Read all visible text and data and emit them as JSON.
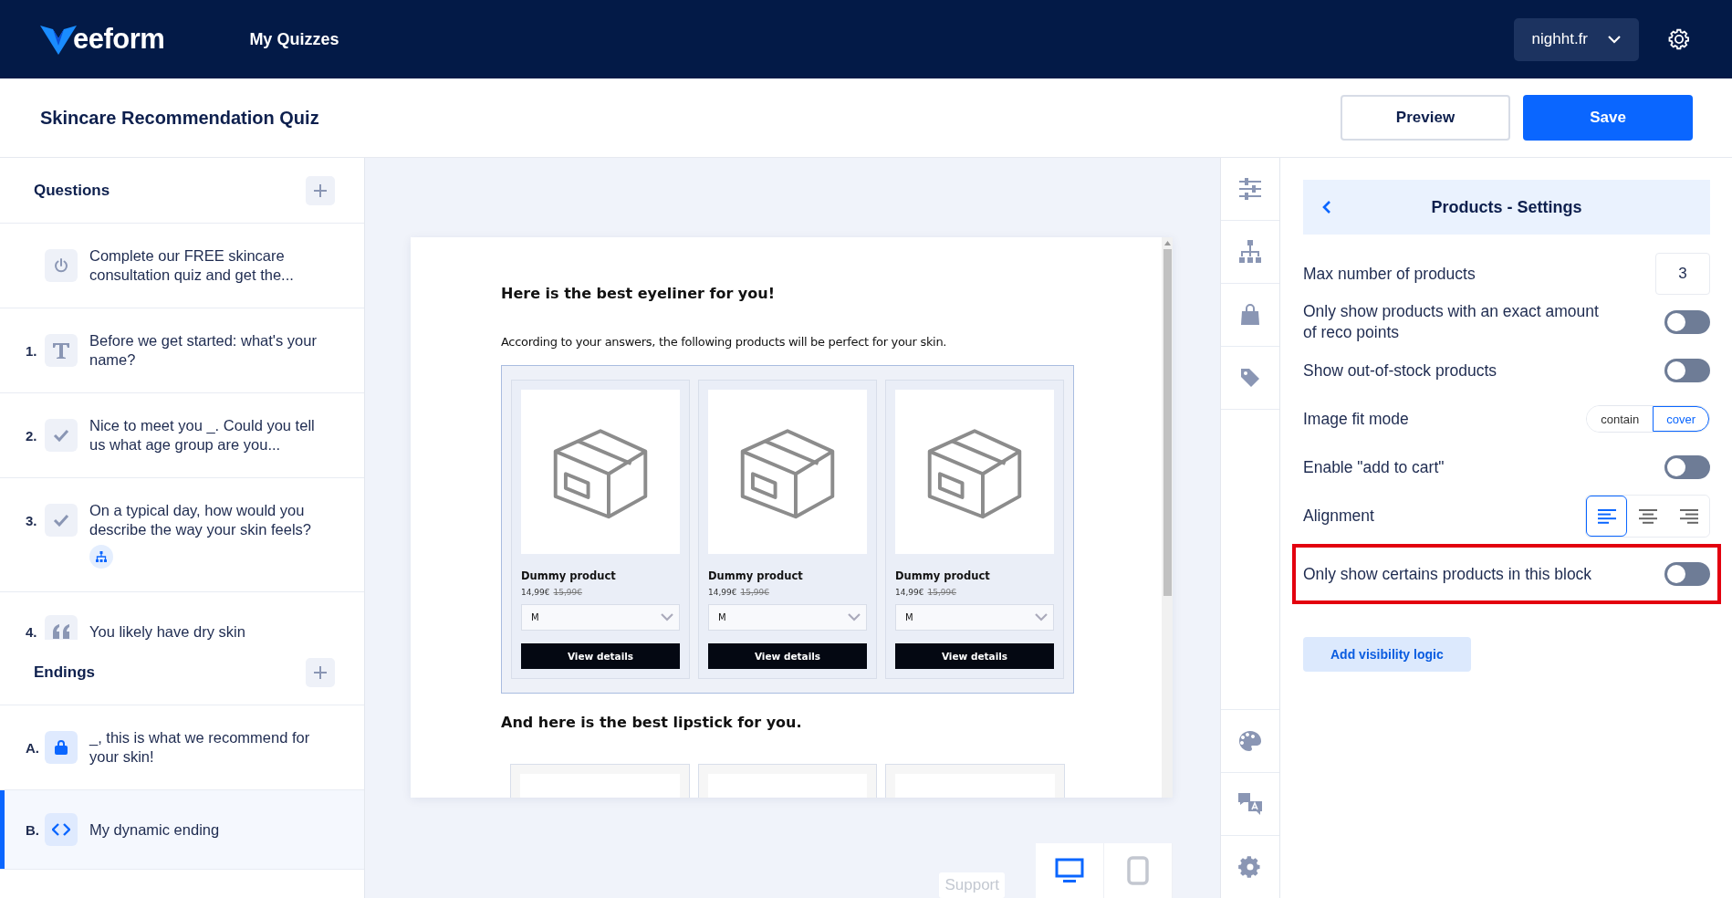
{
  "header": {
    "logo_text": "eeform",
    "nav": [
      {
        "label": "My Quizzes"
      }
    ],
    "account": "nighht.fr"
  },
  "toolbar": {
    "title": "Skincare Recommendation Quiz",
    "buttons": [
      {
        "label": "Preview",
        "kind": "secondary"
      },
      {
        "label": "Save",
        "kind": "primary"
      }
    ]
  },
  "sidebar": {
    "sections": [
      {
        "title": "Questions",
        "items": [
          {
            "kind": "intro",
            "text": "Complete our FREE skincare consultation quiz and get the...",
            "has_logic": false,
            "selected": false
          },
          {
            "number": "1.",
            "kind": "text",
            "text": "Before we get started: what's your name?",
            "has_logic": false,
            "selected": false
          },
          {
            "number": "2.",
            "kind": "choice",
            "text": "Nice to meet you _. Could you tell us what age group are you...",
            "has_logic": false,
            "selected": false
          },
          {
            "number": "3.",
            "kind": "choice",
            "text": "On a typical day, how would you describe the way your skin feels?",
            "has_logic": true,
            "selected": false
          },
          {
            "number": "4.",
            "kind": "quote",
            "text": "You likely have dry skin",
            "has_logic": false,
            "selected": false
          }
        ]
      },
      {
        "title": "Endings",
        "items": [
          {
            "number": "A.",
            "kind": "product",
            "text": "_, this is what we recommend for your skin!",
            "has_logic": false,
            "selected": false
          },
          {
            "number": "B.",
            "kind": "code",
            "text": "My dynamic ending",
            "has_logic": false,
            "selected": true
          }
        ]
      }
    ]
  },
  "preview": {
    "blocks": [
      {
        "heading": "Here is the best eyeliner for you!",
        "text": "According to your answers, the following products will be perfect for your skin.",
        "products": [
          {
            "kind": "full",
            "name": "Dummy product",
            "price": "14,99€",
            "old_price": "15,99€",
            "variant": "M",
            "button": "View details"
          },
          {
            "kind": "full",
            "name": "Dummy product",
            "price": "14,99€",
            "old_price": "15,99€",
            "variant": "M",
            "button": "View details"
          },
          {
            "kind": "full",
            "name": "Dummy product",
            "price": "14,99€",
            "old_price": "15,99€",
            "variant": "M",
            "button": "View details"
          }
        ]
      },
      {
        "heading": "And here is the best lipstick for you.",
        "products": [
          {
            "kind": "cut"
          },
          {
            "kind": "cut"
          },
          {
            "kind": "cut"
          }
        ]
      }
    ],
    "support": "Support",
    "devices": [
      {
        "kind": "desktop",
        "selected": true
      },
      {
        "kind": "tablet",
        "selected": false
      }
    ]
  },
  "rail": {
    "top": [
      {
        "kind": "sliders"
      },
      {
        "kind": "sitemap"
      },
      {
        "kind": "bag"
      },
      {
        "kind": "tag"
      }
    ],
    "bottom": [
      {
        "kind": "palette"
      },
      {
        "kind": "translate"
      },
      {
        "kind": "settings"
      }
    ]
  },
  "settings": {
    "title": "Products - Settings",
    "rows": [
      {
        "kind": "number",
        "label": "Max number of products",
        "value": "3",
        "highlighted": false
      },
      {
        "kind": "toggle",
        "label": "Only show products with an exact amount of reco points",
        "on": false,
        "highlighted": false
      },
      {
        "kind": "toggle",
        "label": "Show out-of-stock products",
        "on": false,
        "highlighted": false
      },
      {
        "kind": "segmented",
        "label": "Image fit mode",
        "options": [
          {
            "label": "contain",
            "selected": false
          },
          {
            "label": "cover",
            "selected": true
          }
        ],
        "highlighted": false
      },
      {
        "kind": "toggle",
        "label": "Enable \"add to cart\"",
        "on": false,
        "highlighted": false
      },
      {
        "kind": "align",
        "label": "Alignment",
        "options": [
          {
            "kind": "left",
            "selected": true
          },
          {
            "kind": "center",
            "selected": false
          },
          {
            "kind": "right",
            "selected": false
          }
        ],
        "highlighted": false
      },
      {
        "kind": "toggle",
        "label": "Only show certains products in this block",
        "on": false,
        "highlighted": true
      }
    ],
    "action": "Add visibility logic"
  }
}
